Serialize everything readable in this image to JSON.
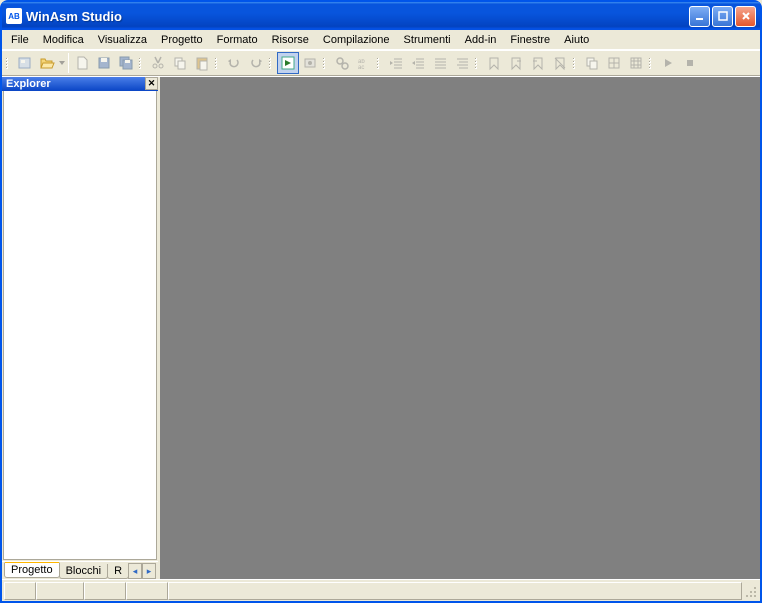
{
  "window": {
    "title": "WinAsm Studio",
    "app_icon_text": "AB"
  },
  "menu": {
    "items": [
      "File",
      "Modifica",
      "Visualizza",
      "Progetto",
      "Formato",
      "Risorse",
      "Compilazione",
      "Strumenti",
      "Add-in",
      "Finestre",
      "Aiuto"
    ]
  },
  "explorer": {
    "title": "Explorer",
    "tabs": [
      "Progetto",
      "Blocchi",
      "R"
    ],
    "selected_tab": 0
  },
  "toolbar": {
    "groups": [
      [
        "new-project-icon",
        "open-folder-icon"
      ],
      [
        "new-file-icon",
        "save-icon",
        "save-all-icon"
      ],
      [
        "cut-icon",
        "copy-icon",
        "paste-icon"
      ],
      [
        "undo-icon",
        "redo-icon"
      ],
      [
        "go-icon",
        "assemble-icon"
      ],
      [
        "find-icon",
        "replace-icon"
      ],
      [
        "outdent-icon",
        "indent-icon",
        "comment-icon",
        "uncomment-icon"
      ],
      [
        "tool1-icon",
        "tool2-icon",
        "tool3-icon",
        "tool4-icon"
      ],
      [
        "copy2-icon",
        "grid-icon",
        "grid2-icon"
      ],
      [
        "play-icon",
        "stop-icon"
      ]
    ]
  }
}
